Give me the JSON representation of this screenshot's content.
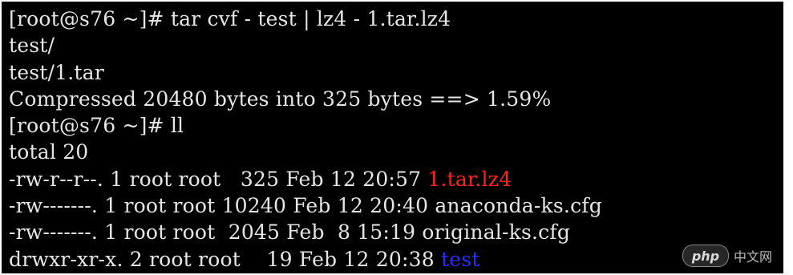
{
  "terminal": {
    "lines": [
      "[root@s76 ~]# tar cvf - test | lz4 - 1.tar.lz4",
      "test/",
      "test/1.tar",
      "Compressed 20480 bytes into 325 bytes ==> 1.59%",
      "[root@s76 ~]# ll",
      "total 20"
    ],
    "listing": [
      {
        "prefix": "-rw-r--r--. 1 root root   325 Feb 12 20:57 ",
        "name": "1.tar.lz4",
        "color": "#ff2222"
      },
      {
        "prefix": "-rw-------. 1 root root 10240 Feb 12 20:40 ",
        "name": "anaconda-ks.cfg",
        "color": "#e6e6e6"
      },
      {
        "prefix": "-rw-------. 1 root root  2045 Feb  8 15:19 ",
        "name": "original-ks.cfg",
        "color": "#e6e6e6"
      },
      {
        "prefix": "drwxr-xr-x. 2 root root    19 Feb 12 20:38 ",
        "name": "test",
        "color": "#2b2bff"
      }
    ]
  },
  "watermark": {
    "logo": "php",
    "text": "中文网"
  },
  "colors": {
    "background": "#000000",
    "foreground": "#e6e6e6",
    "archive": "#ff2222",
    "directory": "#2b2bff"
  }
}
